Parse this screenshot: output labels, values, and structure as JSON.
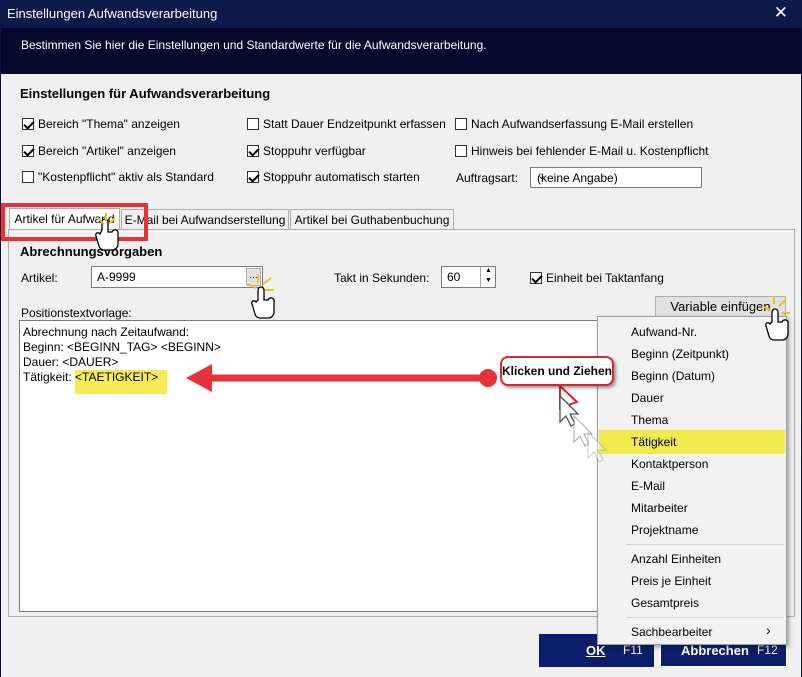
{
  "window": {
    "title": "Einstellungen Aufwandsverarbeitung",
    "close_glyph": "✕"
  },
  "banner": {
    "text": "Bestimmen Sie hier die Einstellungen und Standardwerte für die Aufwandsverarbeitung."
  },
  "settings": {
    "title": "Einstellungen für Aufwandsverarbeitung",
    "col1": [
      {
        "label": "Bereich \"Thema\" anzeigen",
        "checked": true
      },
      {
        "label": "Bereich \"Artikel\" anzeigen",
        "checked": true
      },
      {
        "label": "\"Kostenpflicht\" aktiv als Standard",
        "checked": false
      }
    ],
    "col2": [
      {
        "label": "Statt Dauer Endzeitpunkt erfassen",
        "checked": false
      },
      {
        "label": "Stoppuhr verfügbar",
        "checked": true
      },
      {
        "label": "Stoppuhr automatisch starten",
        "checked": true
      }
    ],
    "col3": [
      {
        "label": "Nach Aufwandserfassung E-Mail erstellen",
        "checked": false
      },
      {
        "label": "Hinweis bei fehlender E-Mail u. Kostenpflicht",
        "checked": false
      }
    ],
    "auftragsart_label": "Auftragsart:",
    "auftragsart_value": "(keine Angabe)"
  },
  "tabs": [
    {
      "label": "Artikel für Aufwand",
      "active": true
    },
    {
      "label": "E-Mail bei Aufwandserstellung",
      "active": false
    },
    {
      "label": "Artikel bei Guthabenbuchung",
      "active": false
    }
  ],
  "tab_content": {
    "group_title": "Abrechnungsvorgaben",
    "artikel_label": "Artikel:",
    "artikel_value": "A-9999",
    "browse_label": "...",
    "takt_label": "Takt in Sekunden:",
    "takt_value": "60",
    "einheit_label": "Einheit bei Taktanfang",
    "einheit_checked": true,
    "positionstext_label": "Positionstextvorlage:",
    "variable_button": "Variable einfügen",
    "template_lines": [
      "Abrechnung nach Zeitaufwand:",
      "Beginn: <BEGINN_TAG> <BEGINN>",
      "Dauer:  <DAUER>",
      "Tätigkeit: "
    ],
    "template_highlight": "<TAETIGKEIT>"
  },
  "variable_menu": {
    "items_group1": [
      "Aufwand-Nr.",
      "Beginn (Zeitpunkt)",
      "Beginn (Datum)",
      "Dauer",
      "Thema",
      "Tätigkeit",
      "Kontaktperson",
      "E-Mail",
      "Mitarbeiter",
      "Projektname"
    ],
    "highlighted": "Tätigkeit",
    "items_group2": [
      "Anzahl Einheiten",
      "Preis je Einheit",
      "Gesamtpreis"
    ],
    "submenu_item": "Sachbearbeiter",
    "submenu_arrow": "›"
  },
  "annotation": {
    "callout_text": "Klicken und Ziehen",
    "arrow_color": "#e8323a",
    "highlight_color": "#f5ec55",
    "frame_color": "#e8323a"
  },
  "footer": {
    "ok_label": "OK",
    "ok_key": "F11",
    "cancel_label": "Abbrechen",
    "cancel_key": "F12"
  }
}
